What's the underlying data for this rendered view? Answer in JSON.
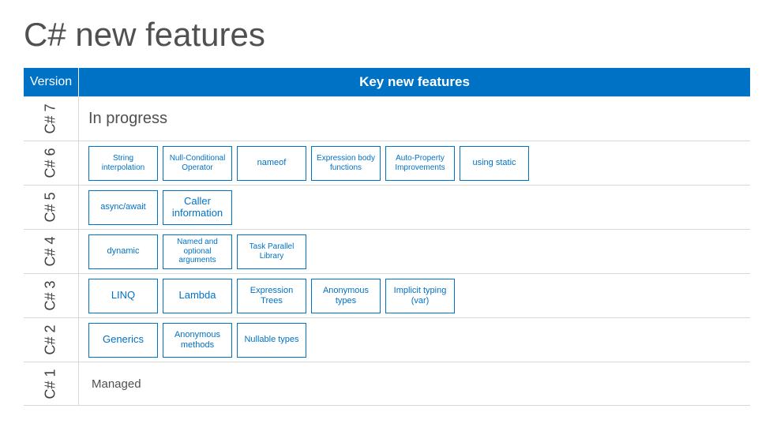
{
  "title": "C# new features",
  "header": {
    "version": "Version",
    "key": "Key new features"
  },
  "rows": [
    {
      "version": "C# 7",
      "inprogress": "In progress",
      "features": []
    },
    {
      "version": "C# 6",
      "features": [
        "String interpolation",
        "Null-Conditional Operator",
        "nameof",
        "Expression body functions",
        "Auto-Property Improvements",
        "using static"
      ]
    },
    {
      "version": "C# 5",
      "features": [
        "async/await",
        "Caller information"
      ]
    },
    {
      "version": "C# 4",
      "features": [
        "dynamic",
        "Named and optional arguments",
        "Task Parallel Library"
      ]
    },
    {
      "version": "C# 3",
      "features": [
        "LINQ",
        "Lambda",
        "Expression Trees",
        "Anonymous types",
        "Implicit typing (var)"
      ]
    },
    {
      "version": "C# 2",
      "features": [
        "Generics",
        "Anonymous methods",
        "Nullable types"
      ]
    },
    {
      "version": "C# 1",
      "managed": "Managed",
      "features": []
    }
  ]
}
